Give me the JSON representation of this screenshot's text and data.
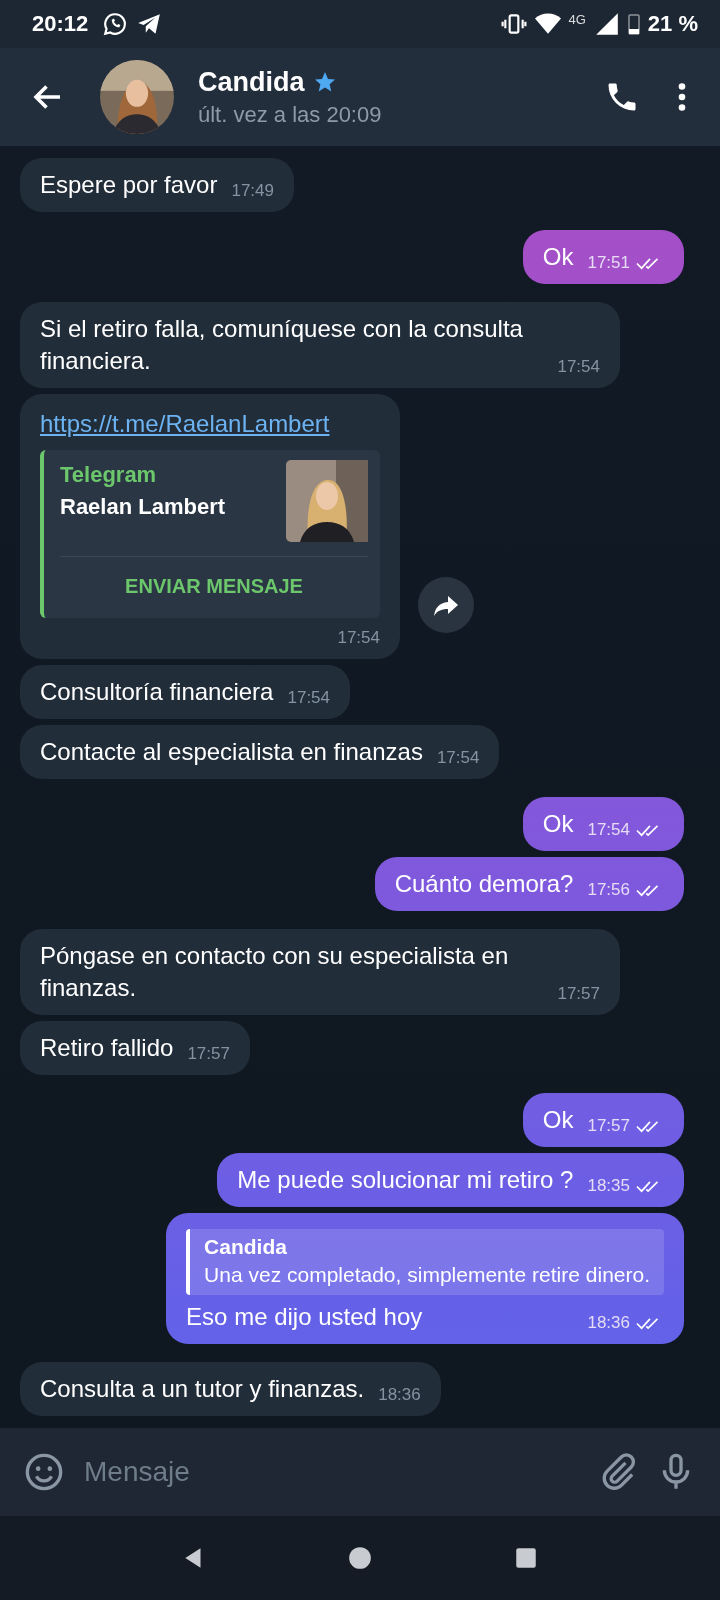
{
  "status_bar": {
    "time": "20:12",
    "network": "4G",
    "battery": "21 %"
  },
  "header": {
    "name": "Candida",
    "verified": true,
    "status": "últ. vez a las 20:09"
  },
  "messages": [
    {
      "kind": "text",
      "outgoing": false,
      "text": "Espere por favor",
      "time": "17:49"
    },
    {
      "kind": "text",
      "outgoing": true,
      "text": "Ok",
      "time": "17:51",
      "read": true
    },
    {
      "kind": "text",
      "outgoing": false,
      "text": "Si el retiro falla, comuníquese con la consulta financiera.",
      "time": "17:54"
    },
    {
      "kind": "link",
      "outgoing": false,
      "url": "https://t.me/RaelanLambert",
      "site": "Telegram",
      "title": "Raelan Lambert",
      "button": "ENVIAR MENSAJE",
      "time": "17:54"
    },
    {
      "kind": "text",
      "outgoing": false,
      "text": "Consultoría financiera",
      "time": "17:54"
    },
    {
      "kind": "text",
      "outgoing": false,
      "text": "Contacte al especialista en finanzas",
      "time": "17:54"
    },
    {
      "kind": "text",
      "outgoing": true,
      "text": "Ok",
      "time": "17:54",
      "read": true
    },
    {
      "kind": "text",
      "outgoing": true,
      "text": "Cuánto demora?",
      "time": "17:56",
      "read": true
    },
    {
      "kind": "text",
      "outgoing": false,
      "text": "Póngase en contacto con su especialista en finanzas.",
      "time": "17:57"
    },
    {
      "kind": "text",
      "outgoing": false,
      "text": "Retiro fallido",
      "time": "17:57"
    },
    {
      "kind": "text",
      "outgoing": true,
      "text": "Ok",
      "time": "17:57",
      "read": true
    },
    {
      "kind": "text",
      "outgoing": true,
      "text": "Me puede solucionar mi retiro ?",
      "time": "18:35",
      "read": true
    },
    {
      "kind": "reply",
      "outgoing": true,
      "quote_author": "Candida",
      "quote_text": "Una vez completado, simplemente retire dinero.",
      "text": "Eso me dijo usted hoy",
      "time": "18:36",
      "read": true
    },
    {
      "kind": "text",
      "outgoing": false,
      "text": "Consulta a un tutor y finanzas.",
      "time": "18:36"
    }
  ],
  "composer": {
    "placeholder": "Mensaje"
  }
}
